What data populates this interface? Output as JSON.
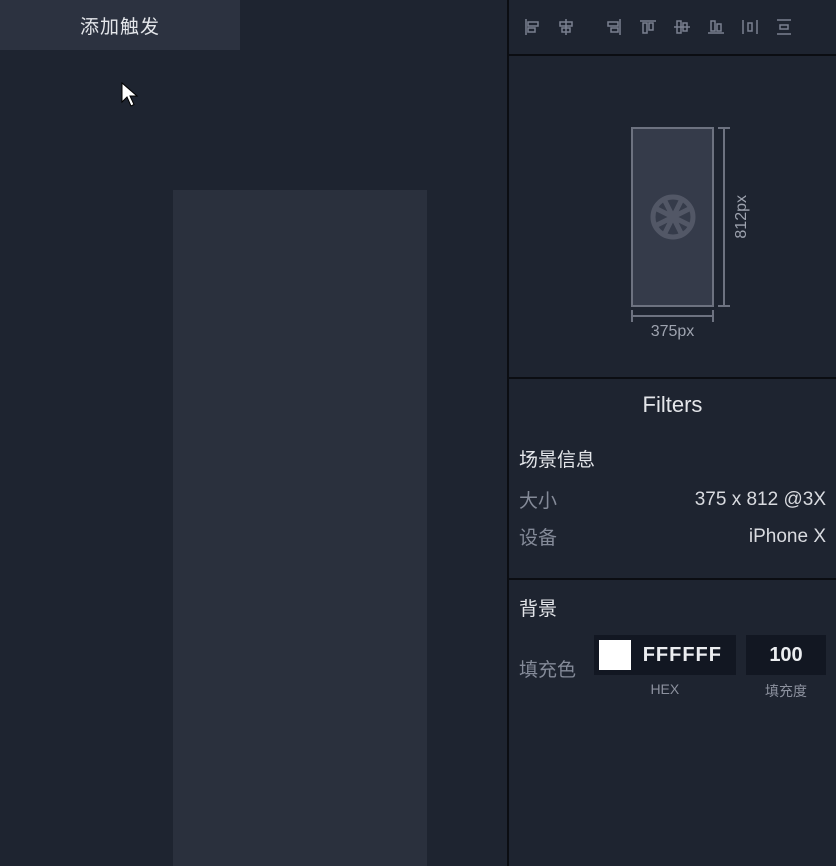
{
  "left": {
    "tab_label": "添加触发"
  },
  "preview": {
    "width_label": "375px",
    "height_label": "812px"
  },
  "filters_title": "Filters",
  "scene": {
    "title": "场景信息",
    "size_label": "大小",
    "size_value": "375 x 812 @3X",
    "device_label": "设备",
    "device_value": "iPhone X"
  },
  "background": {
    "title": "背景",
    "fill_label": "填充色",
    "hex": "FFFFFF",
    "hex_caption": "HEX",
    "opacity": "100",
    "opacity_caption": "填充度"
  }
}
